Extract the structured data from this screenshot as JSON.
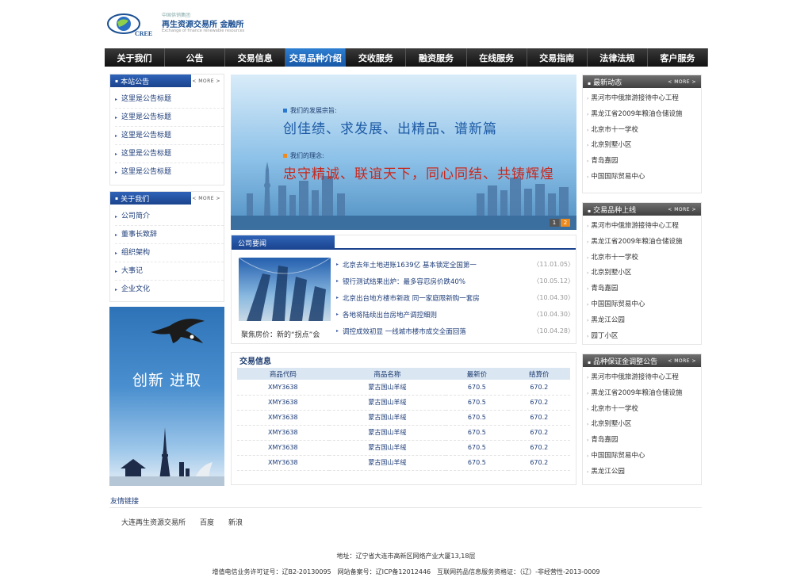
{
  "logo": {
    "sub": "中国供销集团",
    "title": "再生资源交易所 金融所",
    "en": "Exchange of finance renewable resources",
    "mark": "CREE"
  },
  "nav": [
    {
      "label": "关于我们"
    },
    {
      "label": "公告"
    },
    {
      "label": "交易信息"
    },
    {
      "label": "交易品种介绍",
      "active": true
    },
    {
      "label": "交收服务"
    },
    {
      "label": "融资服务"
    },
    {
      "label": "在线服务"
    },
    {
      "label": "交易指南"
    },
    {
      "label": "法律法规"
    },
    {
      "label": "客户服务"
    }
  ],
  "more_label": "< MORE >",
  "left": {
    "notice": {
      "title": "本站公告",
      "items": [
        "这里是公告标题",
        "这里是公告标题",
        "这里是公告标题",
        "这里是公告标题",
        "这里是公告标题"
      ]
    },
    "about": {
      "title": "关于我们",
      "items": [
        "公司简介",
        "董事长致辞",
        "组织架构",
        "大事记",
        "企业文化"
      ]
    },
    "ad_title": "创新 进取"
  },
  "banner": {
    "label1": "我们的发展宗旨:",
    "slogan1": "创佳绩、求发展、出精品、谱新篇",
    "label2": "我们的理念:",
    "slogan2": "忠守精诚、联谊天下，同心同结、共铸辉煌",
    "pager": [
      "1",
      "2"
    ],
    "colors": {
      "label1_dot": "#2a78d0",
      "label2_dot": "#f08a1a"
    }
  },
  "news": {
    "title": "公司要闻",
    "caption": "聚焦房价：新的“拐点”会",
    "items": [
      {
        "text": "北京去年土地进账1639亿 基本锁定全国第一",
        "date": "〈11.01.05〉"
      },
      {
        "text": "银行测试结果出炉：最多容忍房价跌40%",
        "date": "〈10.05.12〉"
      },
      {
        "text": "北京出台地方楼市新政 同一家庭限新购一套房",
        "date": "〈10.04.30〉"
      },
      {
        "text": "各地将陆续出台房地产调控细则",
        "date": "〈10.04.30〉"
      },
      {
        "text": "调控成效初显 一线城市楼市成交全面回落",
        "date": "〈10.04.28〉"
      }
    ]
  },
  "trade": {
    "title": "交易信息",
    "headers": [
      "商品代码",
      "商品名称",
      "最新价",
      "结算价"
    ],
    "rows": [
      [
        "XMY3638",
        "蒙古国山羊绒",
        "670.5",
        "670.2"
      ],
      [
        "XMY3638",
        "蒙古国山羊绒",
        "670.5",
        "670.2"
      ],
      [
        "XMY3638",
        "蒙古国山羊绒",
        "670.5",
        "670.2"
      ],
      [
        "XMY3638",
        "蒙古国山羊绒",
        "670.5",
        "670.2"
      ],
      [
        "XMY3638",
        "蒙古国山羊绒",
        "670.5",
        "670.2"
      ],
      [
        "XMY3638",
        "蒙古国山羊绒",
        "670.5",
        "670.2"
      ]
    ]
  },
  "right": {
    "news": {
      "title": "最新动态",
      "items": [
        "黑河市中俄旅游接待中心工程",
        "黑龙江省2009年粮油仓储设施",
        "北京市十一学校",
        "北京别墅小区",
        "青岛嘉园",
        "中国国际贸易中心"
      ]
    },
    "listing": {
      "title": "交易品种上线",
      "items": [
        "黑河市中俄旅游接待中心工程",
        "黑龙江省2009年粮油仓储设施",
        "北京市十一学校",
        "北京别墅小区",
        "青岛嘉园",
        "中国国际贸易中心",
        "黑龙江公园",
        "园丁小区"
      ]
    },
    "margin": {
      "title": "品种保证金调整公告",
      "items": [
        "黑河市中俄旅游接待中心工程",
        "黑龙江省2009年粮油仓储设施",
        "北京市十一学校",
        "北京别墅小区",
        "青岛嘉园",
        "中国国际贸易中心",
        "黑龙江公园"
      ]
    }
  },
  "links": {
    "title": "友情链接",
    "items": [
      "大连再生资源交易所",
      "百度",
      "新浪"
    ]
  },
  "footer": {
    "address": "地址：辽宁省大连市高新区网络产业大厦13,18层",
    "license": "增值电信业务许可证号：辽B2-20130095　网站备案号：辽ICP备12012446　互联网药品信息服务资格证：（辽）-非经营性-2013-0009"
  }
}
